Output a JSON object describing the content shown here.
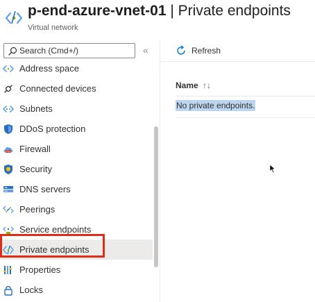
{
  "header": {
    "resource_name": "p-end-azure-vnet-01",
    "separator": " | ",
    "page_title": "Private endpoints",
    "subtitle": "Virtual network",
    "icon": "vnet-icon"
  },
  "sidebar": {
    "search_placeholder": "Search (Cmd+/)",
    "collapse_glyph": "«",
    "items": [
      {
        "label": "Address space",
        "icon": "address-space-icon"
      },
      {
        "label": "Connected devices",
        "icon": "plug-icon"
      },
      {
        "label": "Subnets",
        "icon": "subnets-icon"
      },
      {
        "label": "DDoS protection",
        "icon": "shield-icon"
      },
      {
        "label": "Firewall",
        "icon": "firewall-icon"
      },
      {
        "label": "Security",
        "icon": "security-shield-icon"
      },
      {
        "label": "DNS servers",
        "icon": "dns-icon"
      },
      {
        "label": "Peerings",
        "icon": "peerings-icon"
      },
      {
        "label": "Service endpoints",
        "icon": "service-endpoints-icon"
      },
      {
        "label": "Private endpoints",
        "icon": "private-endpoints-icon",
        "selected": true
      },
      {
        "label": "Properties",
        "icon": "properties-icon"
      },
      {
        "label": "Locks",
        "icon": "lock-icon"
      }
    ]
  },
  "toolbar": {
    "refresh_label": "Refresh"
  },
  "table": {
    "columns": [
      "Name"
    ],
    "sort_glyph": "↑↓",
    "empty_message": "No private endpoints."
  },
  "colors": {
    "accent": "#0078d4",
    "highlight_box": "#e02c16",
    "selection": "#bcd6f0",
    "selected_nav": "#edebe9"
  }
}
